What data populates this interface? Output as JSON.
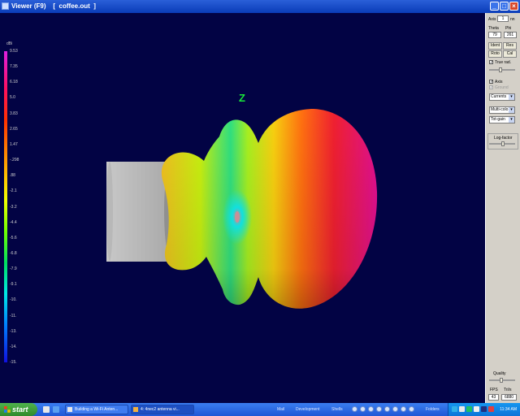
{
  "window": {
    "title": "Viewer (F9)    [  coffee.out  ]",
    "minimize": "_",
    "maximize": "□",
    "close": "×"
  },
  "viewport": {
    "background": "#020344",
    "axis_label": "Z",
    "legend": {
      "unit": "dBi",
      "labels": [
        "9.53",
        "7.35",
        "6.18",
        "5.0",
        "3.83",
        "2.65",
        "1.47",
        "-.298",
        ".88",
        "-2.1",
        "-3.2",
        "-4.4",
        "-5.6",
        "-6.8",
        "-7.9",
        "-9.1",
        "-10.",
        "-11.",
        "-13.",
        "-14.",
        "-15."
      ]
    }
  },
  "panel": {
    "axis_label": "Axis",
    "axis_value": "1",
    "nn_label": "nn",
    "theta_label": "Theta",
    "phi_label": "Phi",
    "theta_value": "79",
    "phi_value": "261",
    "ident_button": "Ident",
    "res_button": "Res",
    "roto_button": "Roto",
    "cal_button": "Cal",
    "true_rad_label": "True rad.",
    "axis_check_label": "Axis",
    "ground_label": "Ground",
    "currents_select": "Currents",
    "multicolor_select": "Multi-colo",
    "totgain_select": "Tot-gain",
    "log_factor_label": "Log-factor",
    "log_factor_value": "1",
    "quality_label": "Quality",
    "fps_label": "FPS",
    "tris_label": "Tri/s",
    "fps_value": "43",
    "tris_value": "6880"
  },
  "taskbar": {
    "start_label": "start",
    "tasks": [
      {
        "label": "Building a Wi-Fi Anten..."
      },
      {
        "label": "4: 4nec2 antenna vi..."
      }
    ],
    "toolbar_labels": [
      "Mail",
      "Development",
      "Shells",
      "Folders"
    ],
    "clock": "11:34 AM"
  }
}
